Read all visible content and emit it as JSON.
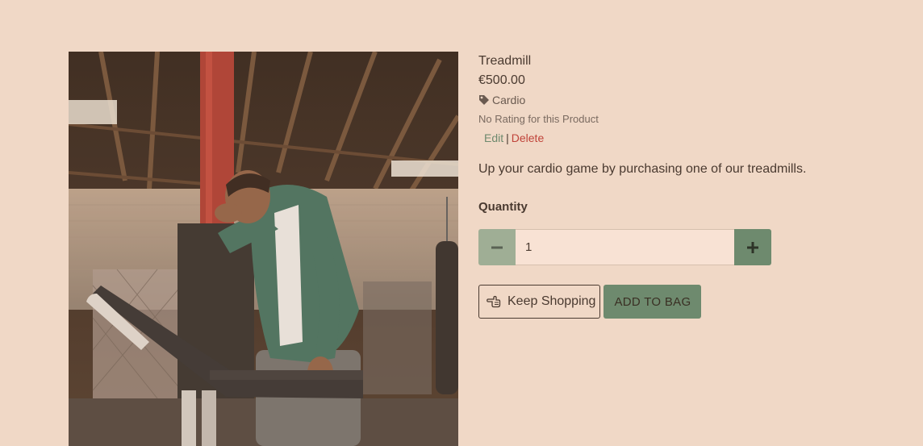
{
  "product": {
    "name": "Treadmill",
    "price": "€500.00",
    "category": "Cardio",
    "rating_text": "No Rating for this Product",
    "description": "Up your cardio game by purchasing one of our treadmills.",
    "image_icon": "product-photo"
  },
  "admin": {
    "edit_label": "Edit",
    "separator": "|",
    "delete_label": "Delete"
  },
  "quantity": {
    "label": "Quantity",
    "value": "1",
    "minus_icon": "minus-icon",
    "plus_icon": "plus-icon"
  },
  "actions": {
    "keep_shopping_label": "Keep Shopping",
    "keep_shopping_icon": "hand-pointing-left-icon",
    "add_to_bag_label": "ADD TO BAG"
  },
  "colors": {
    "background": "#f0d8c6",
    "accent_green": "#6e8a6e",
    "light_green": "#9fae95",
    "delete_red": "#c0443a",
    "input_bg": "#f8e2d4"
  }
}
